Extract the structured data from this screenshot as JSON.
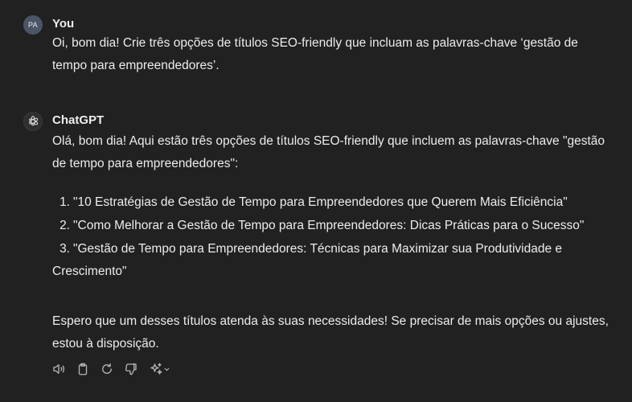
{
  "user_message": {
    "avatar_initials": "PA",
    "author": "You",
    "text": "Oi, bom dia! Crie três opções de títulos SEO-friendly que incluam as palavras-chave ‘gestão de tempo para empreendedores’."
  },
  "assistant_message": {
    "author": "ChatGPT",
    "intro": "Olá, bom dia! Aqui estão três opções de títulos SEO-friendly que incluem as palavras-chave \"gestão de tempo para empreendedores\":",
    "options": [
      {
        "num": "1.",
        "text": "\"10 Estratégias de Gestão de Tempo para Empreendedores que Querem Mais Eficiência\""
      },
      {
        "num": "2.",
        "text": "\"Como Melhorar a Gestão de Tempo para Empreendedores: Dicas Práticas para o Sucesso\""
      },
      {
        "num": "3.",
        "text": "\"Gestão de Tempo para Empreendedores: Técnicas para Maximizar sua Produtividade e Crescimento\""
      }
    ],
    "closing": "Espero que um desses títulos atenda às suas necessidades! Se precisar de mais opções ou ajustes, estou à disposição."
  },
  "actions": [
    {
      "icon": "speaker-icon"
    },
    {
      "icon": "clipboard-icon"
    },
    {
      "icon": "regenerate-icon"
    },
    {
      "icon": "thumbs-down-icon"
    },
    {
      "icon": "sparkle-model-icon"
    }
  ],
  "colors": {
    "background": "#212121",
    "text": "#ececec",
    "icon": "#b4b4b4",
    "user_avatar": "#4a5566"
  }
}
